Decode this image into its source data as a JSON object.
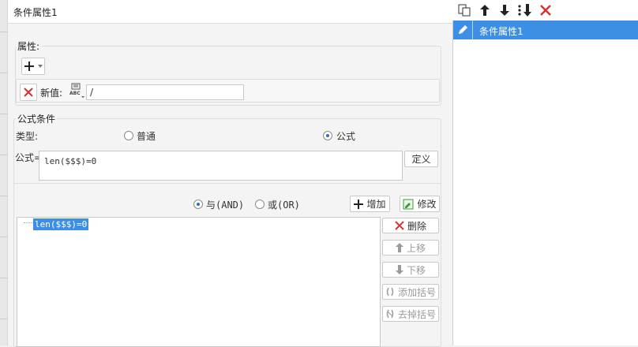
{
  "dialog": {
    "title": "条件属性1"
  },
  "attributes": {
    "legend": "属性:",
    "add_label": "+",
    "new_value_label": "新值:",
    "new_value": "/",
    "abc_label": "ABC"
  },
  "formula_condition": {
    "legend": "公式条件",
    "type_label": "类型:",
    "type_options": [
      {
        "label": "普通",
        "selected": false
      },
      {
        "label": "公式",
        "selected": true
      }
    ],
    "formula_label": "公式=",
    "formula_value": "len($$$)=0",
    "define_button": "定义",
    "logic_options": [
      {
        "label": "与(AND)",
        "selected": true
      },
      {
        "label": "或(OR)",
        "selected": false
      }
    ],
    "add_button": "增加",
    "modify_button": "修改",
    "conditions": [
      "len($$$)=0"
    ],
    "side_buttons": {
      "delete": "删除",
      "move_up": "上移",
      "move_down": "下移",
      "add_bracket": "添加括号",
      "remove_bracket": "去掉括号"
    }
  },
  "right_panel": {
    "items": [
      {
        "label": "条件属性1",
        "selected": true
      }
    ]
  },
  "colors": {
    "accent": "#3c8fe4",
    "delete_red": "#d9302c",
    "modify_green": "#3b9a3b"
  }
}
